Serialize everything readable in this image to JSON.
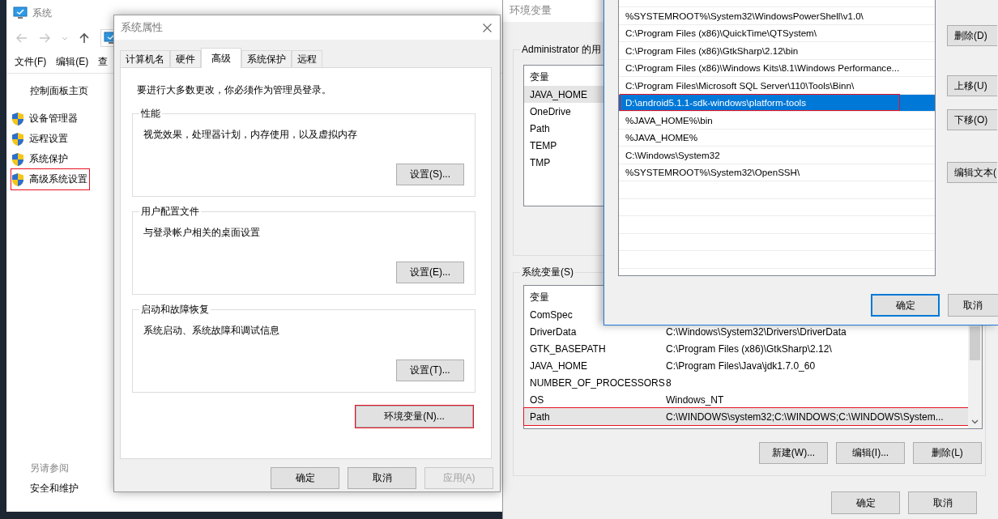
{
  "system_window": {
    "title": "系统",
    "menu": [
      "文件(F)",
      "编辑(E)",
      "查"
    ],
    "sidebar_home": "控制面板主页",
    "sidebar_items": [
      {
        "label": "设备管理器",
        "annotated": false
      },
      {
        "label": "远程设置",
        "annotated": false
      },
      {
        "label": "系统保护",
        "annotated": false
      },
      {
        "label": "高级系统设置",
        "annotated": true
      }
    ],
    "see_also": "另请参阅",
    "see_also_items": [
      "安全和维护"
    ]
  },
  "system_properties": {
    "title": "系统属性",
    "tabs": [
      {
        "label": "计算机名",
        "selected": false
      },
      {
        "label": "硬件",
        "selected": false
      },
      {
        "label": "高级",
        "selected": true
      },
      {
        "label": "系统保护",
        "selected": false
      },
      {
        "label": "远程",
        "selected": false
      }
    ],
    "note": "要进行大多数更改，你必须作为管理员登录。",
    "groups": [
      {
        "title": "性能",
        "description": "视觉效果，处理器计划，内存使用，以及虚拟内存",
        "button": "设置(S)..."
      },
      {
        "title": "用户配置文件",
        "description": "与登录帐户相关的桌面设置",
        "button": "设置(E)..."
      },
      {
        "title": "启动和故障恢复",
        "description": "系统启动、系统故障和调试信息",
        "button": "设置(T)..."
      }
    ],
    "env_button": {
      "label": "环境变量(N)...",
      "annotated": true
    },
    "buttons": [
      {
        "label": "确定",
        "disabled": false
      },
      {
        "label": "取消",
        "disabled": false
      },
      {
        "label": "应用(A)",
        "disabled": true
      }
    ]
  },
  "environment_variables": {
    "title": "环境变量",
    "user_group": "Administrator 的用",
    "user_table": {
      "header": "变量",
      "rows": [
        {
          "name": "JAVA_HOME",
          "selected": true
        },
        {
          "name": "OneDrive",
          "selected": false
        },
        {
          "name": "Path",
          "selected": false
        },
        {
          "name": "TEMP",
          "selected": false
        },
        {
          "name": "TMP",
          "selected": false
        }
      ]
    },
    "system_group": "系统变量(S)",
    "system_table": {
      "header": "变量",
      "rows": [
        {
          "name": "ComSpec",
          "selected": false,
          "annotated": false
        },
        {
          "name": "DriverData",
          "value": "C:\\Windows\\System32\\Drivers\\DriverData",
          "selected": false,
          "annotated": false
        },
        {
          "name": "GTK_BASEPATH",
          "value": "C:\\Program Files (x86)\\GtkSharp\\2.12\\",
          "selected": false,
          "annotated": false
        },
        {
          "name": "JAVA_HOME",
          "value": "C:\\Program Files\\Java\\jdk1.7.0_60",
          "selected": false,
          "annotated": false
        },
        {
          "name": "NUMBER_OF_PROCESSORS",
          "value": "8",
          "selected": false,
          "annotated": false
        },
        {
          "name": "OS",
          "value": "Windows_NT",
          "selected": false,
          "annotated": false
        },
        {
          "name": "Path",
          "value": "C:\\WINDOWS\\system32;C:\\WINDOWS;C:\\WINDOWS\\System...",
          "selected": true,
          "annotated": true
        }
      ]
    },
    "system_buttons": [
      "新建(W)...",
      "编辑(I)...",
      "删除(L)"
    ],
    "buttons": [
      "确定",
      "取消"
    ]
  },
  "edit_dialog": {
    "entries": [
      {
        "text": "%SYSTEMROOT%\\System32\\WindowsPowerShell\\v1.0\\",
        "selected": false,
        "annotated": false
      },
      {
        "text": "C:\\Program Files (x86)\\QuickTime\\QTSystem\\",
        "selected": false,
        "annotated": false
      },
      {
        "text": "C:\\Program Files (x86)\\GtkSharp\\2.12\\bin",
        "selected": false,
        "annotated": false
      },
      {
        "text": "C:\\Program Files (x86)\\Windows Kits\\8.1\\Windows Performance...",
        "selected": false,
        "annotated": false
      },
      {
        "text": "C:\\Program Files\\Microsoft SQL Server\\110\\Tools\\Binn\\",
        "selected": false,
        "annotated": false
      },
      {
        "text": "D:\\android5.1.1-sdk-windows\\platform-tools",
        "selected": true,
        "annotated": true
      },
      {
        "text": "%JAVA_HOME%\\bin",
        "selected": false,
        "annotated": false
      },
      {
        "text": "%JAVA_HOME%",
        "selected": false,
        "annotated": false
      },
      {
        "text": "C:\\Windows\\System32",
        "selected": false,
        "annotated": false
      },
      {
        "text": "%SYSTEMROOT%\\System32\\OpenSSH\\",
        "selected": false,
        "annotated": false
      }
    ],
    "side_buttons": [
      "删除(D)",
      "上移(U)",
      "下移(O)",
      "编辑文本("
    ],
    "buttons": [
      {
        "label": "确定",
        "focused": true
      },
      {
        "label": "取消",
        "focused": false
      }
    ]
  }
}
